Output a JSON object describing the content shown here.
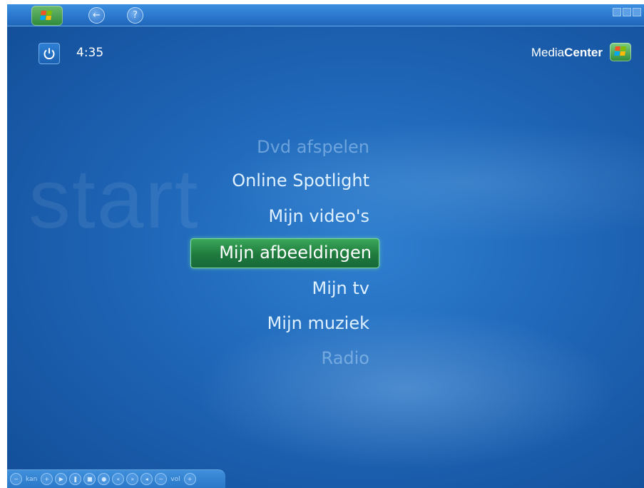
{
  "topbar": {
    "start_icon": "windows-logo-icon",
    "back_icon": "back-arrow-icon",
    "help_icon": "help-icon",
    "help_glyph": "?",
    "back_glyph": "←"
  },
  "status": {
    "time": "4:35",
    "power_icon": "power-icon"
  },
  "brand": {
    "media": "Media",
    "center": "Center"
  },
  "watermark": "start",
  "menu": {
    "items": [
      {
        "label": "Dvd afspelen",
        "state": "faded"
      },
      {
        "label": "Online Spotlight",
        "state": "normal"
      },
      {
        "label": "Mijn video's",
        "state": "normal"
      },
      {
        "label": "Mijn afbeeldingen",
        "state": "selected"
      },
      {
        "label": "Mijn tv",
        "state": "normal"
      },
      {
        "label": "Mijn muziek",
        "state": "normal"
      },
      {
        "label": "Radio",
        "state": "faded"
      }
    ]
  },
  "transport": {
    "channel_label": "kan",
    "volume_label": "vol",
    "minus": "−",
    "plus": "+"
  },
  "colors": {
    "background": "#1f66b7",
    "selection": "#2a8f48",
    "text": "#dff0ff"
  }
}
